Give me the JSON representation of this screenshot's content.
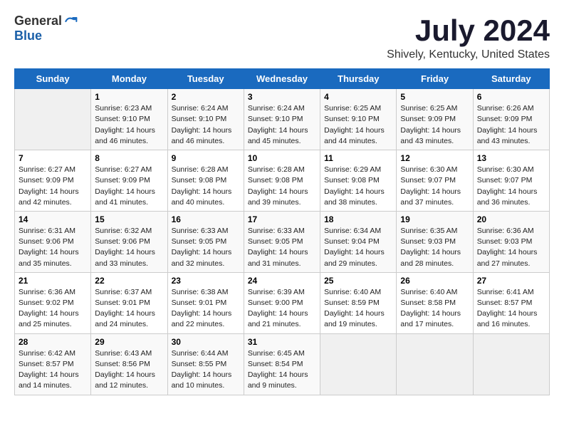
{
  "header": {
    "logo_general": "General",
    "logo_blue": "Blue",
    "month_year": "July 2024",
    "location": "Shively, Kentucky, United States"
  },
  "days_of_week": [
    "Sunday",
    "Monday",
    "Tuesday",
    "Wednesday",
    "Thursday",
    "Friday",
    "Saturday"
  ],
  "weeks": [
    [
      {
        "day": "",
        "content": ""
      },
      {
        "day": "1",
        "content": "Sunrise: 6:23 AM\nSunset: 9:10 PM\nDaylight: 14 hours and 46 minutes."
      },
      {
        "day": "2",
        "content": "Sunrise: 6:24 AM\nSunset: 9:10 PM\nDaylight: 14 hours and 46 minutes."
      },
      {
        "day": "3",
        "content": "Sunrise: 6:24 AM\nSunset: 9:10 PM\nDaylight: 14 hours and 45 minutes."
      },
      {
        "day": "4",
        "content": "Sunrise: 6:25 AM\nSunset: 9:10 PM\nDaylight: 14 hours and 44 minutes."
      },
      {
        "day": "5",
        "content": "Sunrise: 6:25 AM\nSunset: 9:09 PM\nDaylight: 14 hours and 43 minutes."
      },
      {
        "day": "6",
        "content": "Sunrise: 6:26 AM\nSunset: 9:09 PM\nDaylight: 14 hours and 43 minutes."
      }
    ],
    [
      {
        "day": "7",
        "content": "Sunrise: 6:27 AM\nSunset: 9:09 PM\nDaylight: 14 hours and 42 minutes."
      },
      {
        "day": "8",
        "content": "Sunrise: 6:27 AM\nSunset: 9:09 PM\nDaylight: 14 hours and 41 minutes."
      },
      {
        "day": "9",
        "content": "Sunrise: 6:28 AM\nSunset: 9:08 PM\nDaylight: 14 hours and 40 minutes."
      },
      {
        "day": "10",
        "content": "Sunrise: 6:28 AM\nSunset: 9:08 PM\nDaylight: 14 hours and 39 minutes."
      },
      {
        "day": "11",
        "content": "Sunrise: 6:29 AM\nSunset: 9:08 PM\nDaylight: 14 hours and 38 minutes."
      },
      {
        "day": "12",
        "content": "Sunrise: 6:30 AM\nSunset: 9:07 PM\nDaylight: 14 hours and 37 minutes."
      },
      {
        "day": "13",
        "content": "Sunrise: 6:30 AM\nSunset: 9:07 PM\nDaylight: 14 hours and 36 minutes."
      }
    ],
    [
      {
        "day": "14",
        "content": "Sunrise: 6:31 AM\nSunset: 9:06 PM\nDaylight: 14 hours and 35 minutes."
      },
      {
        "day": "15",
        "content": "Sunrise: 6:32 AM\nSunset: 9:06 PM\nDaylight: 14 hours and 33 minutes."
      },
      {
        "day": "16",
        "content": "Sunrise: 6:33 AM\nSunset: 9:05 PM\nDaylight: 14 hours and 32 minutes."
      },
      {
        "day": "17",
        "content": "Sunrise: 6:33 AM\nSunset: 9:05 PM\nDaylight: 14 hours and 31 minutes."
      },
      {
        "day": "18",
        "content": "Sunrise: 6:34 AM\nSunset: 9:04 PM\nDaylight: 14 hours and 29 minutes."
      },
      {
        "day": "19",
        "content": "Sunrise: 6:35 AM\nSunset: 9:03 PM\nDaylight: 14 hours and 28 minutes."
      },
      {
        "day": "20",
        "content": "Sunrise: 6:36 AM\nSunset: 9:03 PM\nDaylight: 14 hours and 27 minutes."
      }
    ],
    [
      {
        "day": "21",
        "content": "Sunrise: 6:36 AM\nSunset: 9:02 PM\nDaylight: 14 hours and 25 minutes."
      },
      {
        "day": "22",
        "content": "Sunrise: 6:37 AM\nSunset: 9:01 PM\nDaylight: 14 hours and 24 minutes."
      },
      {
        "day": "23",
        "content": "Sunrise: 6:38 AM\nSunset: 9:01 PM\nDaylight: 14 hours and 22 minutes."
      },
      {
        "day": "24",
        "content": "Sunrise: 6:39 AM\nSunset: 9:00 PM\nDaylight: 14 hours and 21 minutes."
      },
      {
        "day": "25",
        "content": "Sunrise: 6:40 AM\nSunset: 8:59 PM\nDaylight: 14 hours and 19 minutes."
      },
      {
        "day": "26",
        "content": "Sunrise: 6:40 AM\nSunset: 8:58 PM\nDaylight: 14 hours and 17 minutes."
      },
      {
        "day": "27",
        "content": "Sunrise: 6:41 AM\nSunset: 8:57 PM\nDaylight: 14 hours and 16 minutes."
      }
    ],
    [
      {
        "day": "28",
        "content": "Sunrise: 6:42 AM\nSunset: 8:57 PM\nDaylight: 14 hours and 14 minutes."
      },
      {
        "day": "29",
        "content": "Sunrise: 6:43 AM\nSunset: 8:56 PM\nDaylight: 14 hours and 12 minutes."
      },
      {
        "day": "30",
        "content": "Sunrise: 6:44 AM\nSunset: 8:55 PM\nDaylight: 14 hours and 10 minutes."
      },
      {
        "day": "31",
        "content": "Sunrise: 6:45 AM\nSunset: 8:54 PM\nDaylight: 14 hours and 9 minutes."
      },
      {
        "day": "",
        "content": ""
      },
      {
        "day": "",
        "content": ""
      },
      {
        "day": "",
        "content": ""
      }
    ]
  ]
}
